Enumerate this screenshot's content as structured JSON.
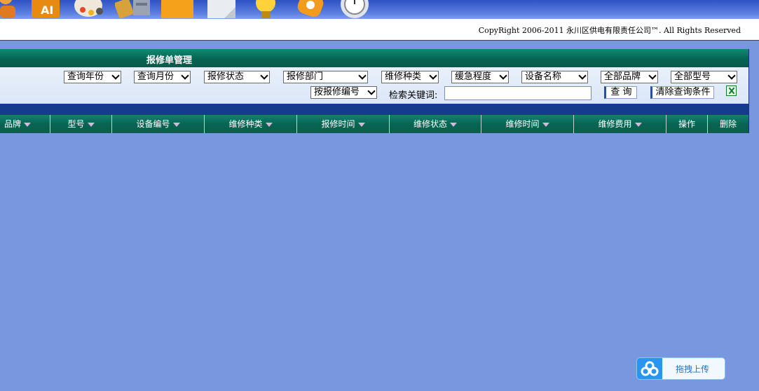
{
  "copyright": "CopyRight 2006-2011 永川区供电有限责任公司™. All Rights Reserved",
  "panel": {
    "title": "报修单管理"
  },
  "filters": {
    "year": "查询年份",
    "month": "查询月份",
    "status": "报修状态",
    "dept": "报修部门",
    "category": "维修种类",
    "urgency": "缓急程度",
    "device_name": "设备名称",
    "brand": "全部品牌",
    "model": "全部型号",
    "order_by": "按报修编号",
    "keyword_label": "检索关键词:",
    "keyword_value": "",
    "query_button": "查 询",
    "clear_button": "清除查询条件"
  },
  "columns": [
    "品牌",
    "型号",
    "设备编号",
    "维修种类",
    "报修时间",
    "维修状态",
    "维修时间",
    "维修费用",
    "操作",
    "删除"
  ],
  "upload": {
    "label": "拖拽上传"
  }
}
